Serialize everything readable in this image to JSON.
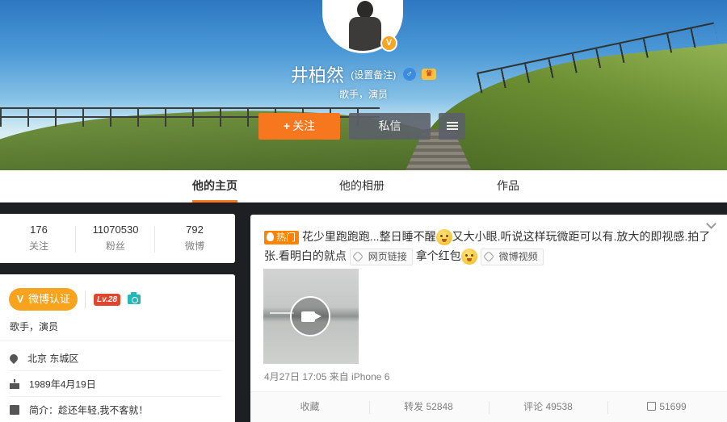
{
  "profile": {
    "name": "井柏然",
    "remark_label": "(设置备注)",
    "gender_icon": "male-icon",
    "member_icon": "vip-member-icon",
    "intro": "歌手，演员",
    "follow_label": "关注",
    "follow_plus": "+",
    "message_label": "私信",
    "more_icon": "menu-icon",
    "verified_badge": "V"
  },
  "tabs": [
    {
      "label": "他的主页",
      "active": true
    },
    {
      "label": "他的相册",
      "active": false
    },
    {
      "label": "作品",
      "active": false
    }
  ],
  "counts": [
    {
      "num": "176",
      "label": "关注"
    },
    {
      "num": "11070530",
      "label": "粉丝"
    },
    {
      "num": "792",
      "label": "微博"
    }
  ],
  "info": {
    "verify_label": "微博认证",
    "verify_v": "V",
    "level": "Lv.28",
    "verify_text": "歌手，演员",
    "location": "北京 东城区",
    "birthday": "1989年4月19日",
    "bio": "简介：趁还年轻,我不客就！"
  },
  "post": {
    "hot_label": "热门",
    "text_1": "花少里跑跑跑...整日睡不醒",
    "text_2": "又大小眼.听说这样玩微距可以有.放大的即视感.拍了张.看明白的就点",
    "chip_link": "网页链接",
    "text_3": "拿个红包",
    "chip_video": "微博视频",
    "meta": "4月27日 17:05 来自 iPhone 6",
    "actions": {
      "favorite": "收藏",
      "repost": "转发 52848",
      "comment": "评论 49538",
      "like": "51699"
    }
  },
  "colors": {
    "accent": "#f7771f",
    "hot": "#ff8200",
    "verify": "#f7a31d",
    "level": "#e2452d"
  }
}
